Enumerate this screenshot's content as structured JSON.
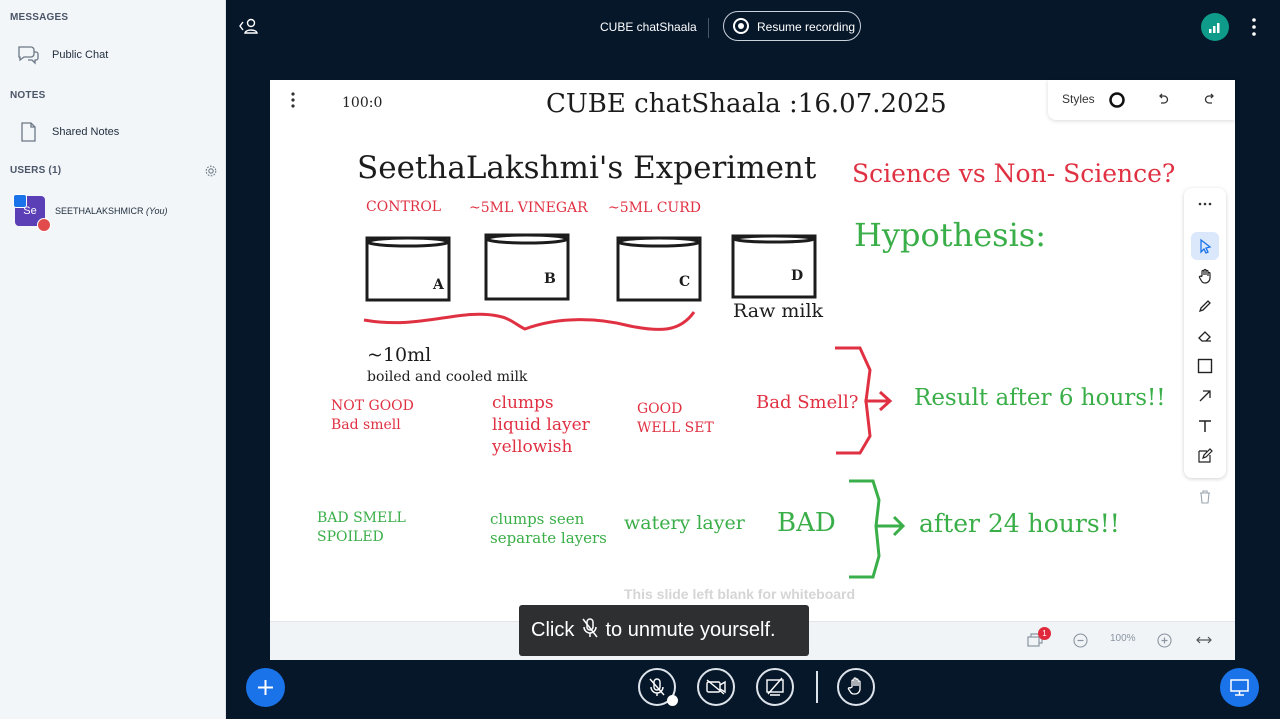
{
  "sidebar": {
    "messages_title": "MESSAGES",
    "public_chat": "Public Chat",
    "notes_title": "NOTES",
    "shared_notes": "Shared Notes",
    "users_title": "USERS (1)",
    "user_initials": "Se",
    "user_name": "SEETHALAKSHMICR",
    "user_you": "(You)"
  },
  "topbar": {
    "title": "CUBE chatShaala",
    "record_label": "Resume recording"
  },
  "board": {
    "zoom_readout": "100:0",
    "title": "CUBE chatShaala :16.07.2025",
    "experiment_title": "SeethaLakshmi's Experiment",
    "science_question": "Science vs Non- Science?",
    "hypothesis": "Hypothesis:",
    "labels": {
      "control": "CONTROL",
      "vinegar": "~5ML VINEGAR",
      "curd": "~5ML CURD"
    },
    "jars": {
      "a": "A",
      "b": "B",
      "c": "C",
      "d": "D"
    },
    "raw_milk": "Raw milk",
    "volume": "~10ml",
    "milk_desc": "boiled and cooled milk",
    "r6": {
      "a1": "NOT GOOD",
      "a2": "Bad smell",
      "b1": "clumps",
      "b2": "liquid layer",
      "b3": "yellowish",
      "c1": "GOOD",
      "c2": "WELL SET",
      "d": "Bad Smell?",
      "result": "Result after 6 hours!!"
    },
    "r24": {
      "a1": "BAD SMELL",
      "a2": "SPOILED",
      "b1": "clumps seen",
      "b2": "separate layers",
      "c": "watery layer",
      "d": "BAD",
      "result": "after 24 hours!!"
    },
    "styles_label": "Styles",
    "blank_note": "This slide left blank for whiteboard",
    "zoom_pct": "100%",
    "notification_count": "1"
  },
  "toast": {
    "before": "Click",
    "after": "to unmute yourself."
  }
}
